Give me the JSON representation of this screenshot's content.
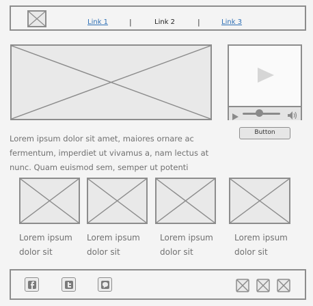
{
  "header": {
    "logo_icon": "image-placeholder-icon",
    "nav": [
      {
        "label": "Link 1"
      },
      {
        "label": "Link 2"
      },
      {
        "label": "Link 3"
      }
    ],
    "separator": "|"
  },
  "hero": {
    "image_icon": "image-placeholder-icon"
  },
  "video": {
    "play_icon": "play-icon",
    "volume_icon": "volume-icon",
    "slider_level": 0.45
  },
  "button": {
    "label": "Button"
  },
  "intro": {
    "lines": [
      "Lorem ipsum dolor sit amet, maiores ornare ac",
      "fermentum, imperdiet ut vivamus a, nam lectus at",
      "nunc. Quam euismod sem, semper ut potenti"
    ]
  },
  "gallery": [
    {
      "line1": "Lorem ipsum",
      "line2": "dolor sit"
    },
    {
      "line1": "Lorem ipsum",
      "line2": "dolor sit"
    },
    {
      "line1": "Lorem ipsum",
      "line2": "dolor sit"
    },
    {
      "line1": "Lorem ipsum",
      "line2": "dolor sit"
    }
  ],
  "footer": {
    "social": [
      "facebook-icon",
      "twitter-icon",
      "chat-icon"
    ],
    "right_icons": [
      "image-placeholder-icon",
      "image-placeholder-icon",
      "image-placeholder-icon"
    ]
  },
  "colors": {
    "link": "#2d6fb5",
    "border": "#8c8c8c",
    "background": "#f4f4f4"
  }
}
